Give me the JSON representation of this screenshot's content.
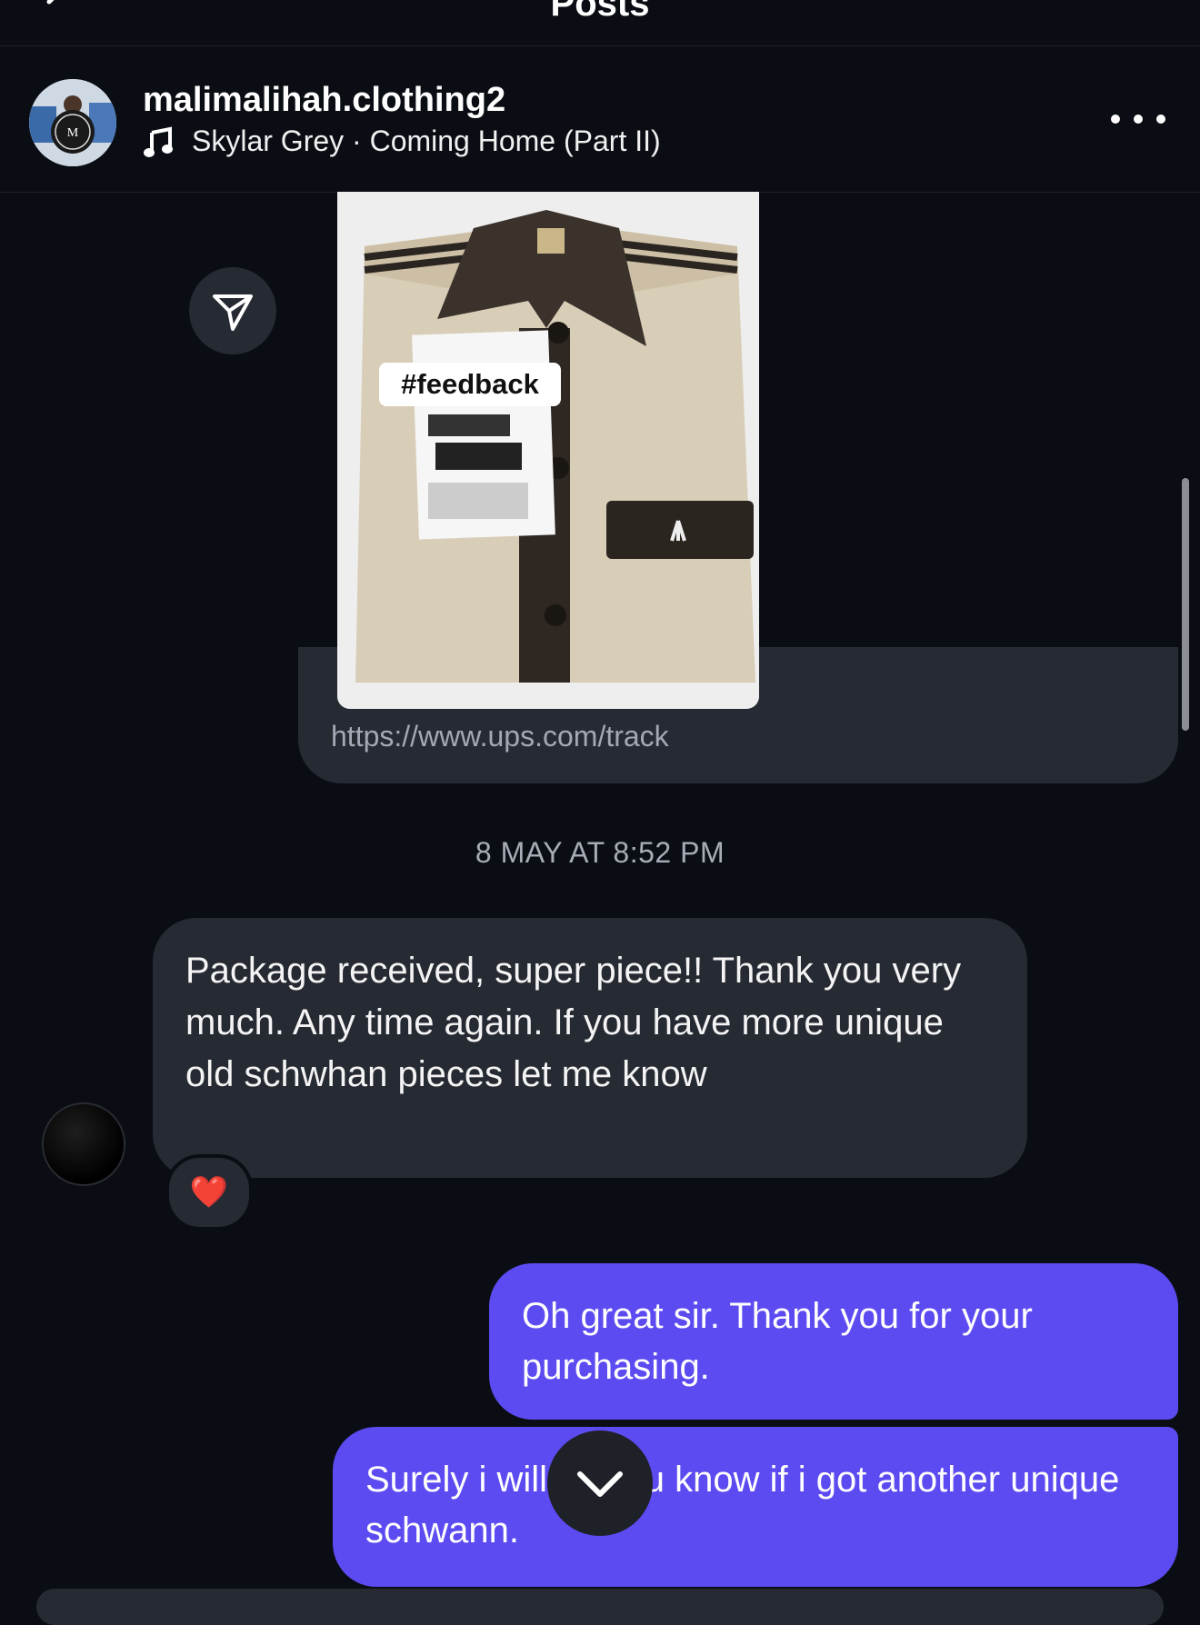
{
  "header": {
    "title": "Posts"
  },
  "profile": {
    "username": "malimalihah.clothing2",
    "music": "Skylar Grey · Coming Home (Part II)",
    "more_icon": "more-horizontal-icon"
  },
  "shared_post": {
    "sticker": "#feedback",
    "link_url": "https://www.ups.com/track",
    "share_icon": "paper-plane-icon"
  },
  "thread": {
    "timestamp": "8 MAY AT 8:52 PM",
    "messages": [
      {
        "from": "them",
        "text": "Package received, super piece!! Thank you very much. Any time again. If you have more unique old schwhan pieces let me know",
        "reaction": "❤️"
      },
      {
        "from": "me",
        "text": "Oh great sir. Thank you for your purchasing."
      },
      {
        "from": "me",
        "text": "Surely i will let you know if i got another unique schwann."
      }
    ]
  },
  "colors": {
    "background": "#0b0d14",
    "incoming_bubble": "#262a33",
    "outgoing_bubble": "#5c4bf0",
    "text": "#f2f2f2",
    "muted_text": "#a8acb6"
  }
}
